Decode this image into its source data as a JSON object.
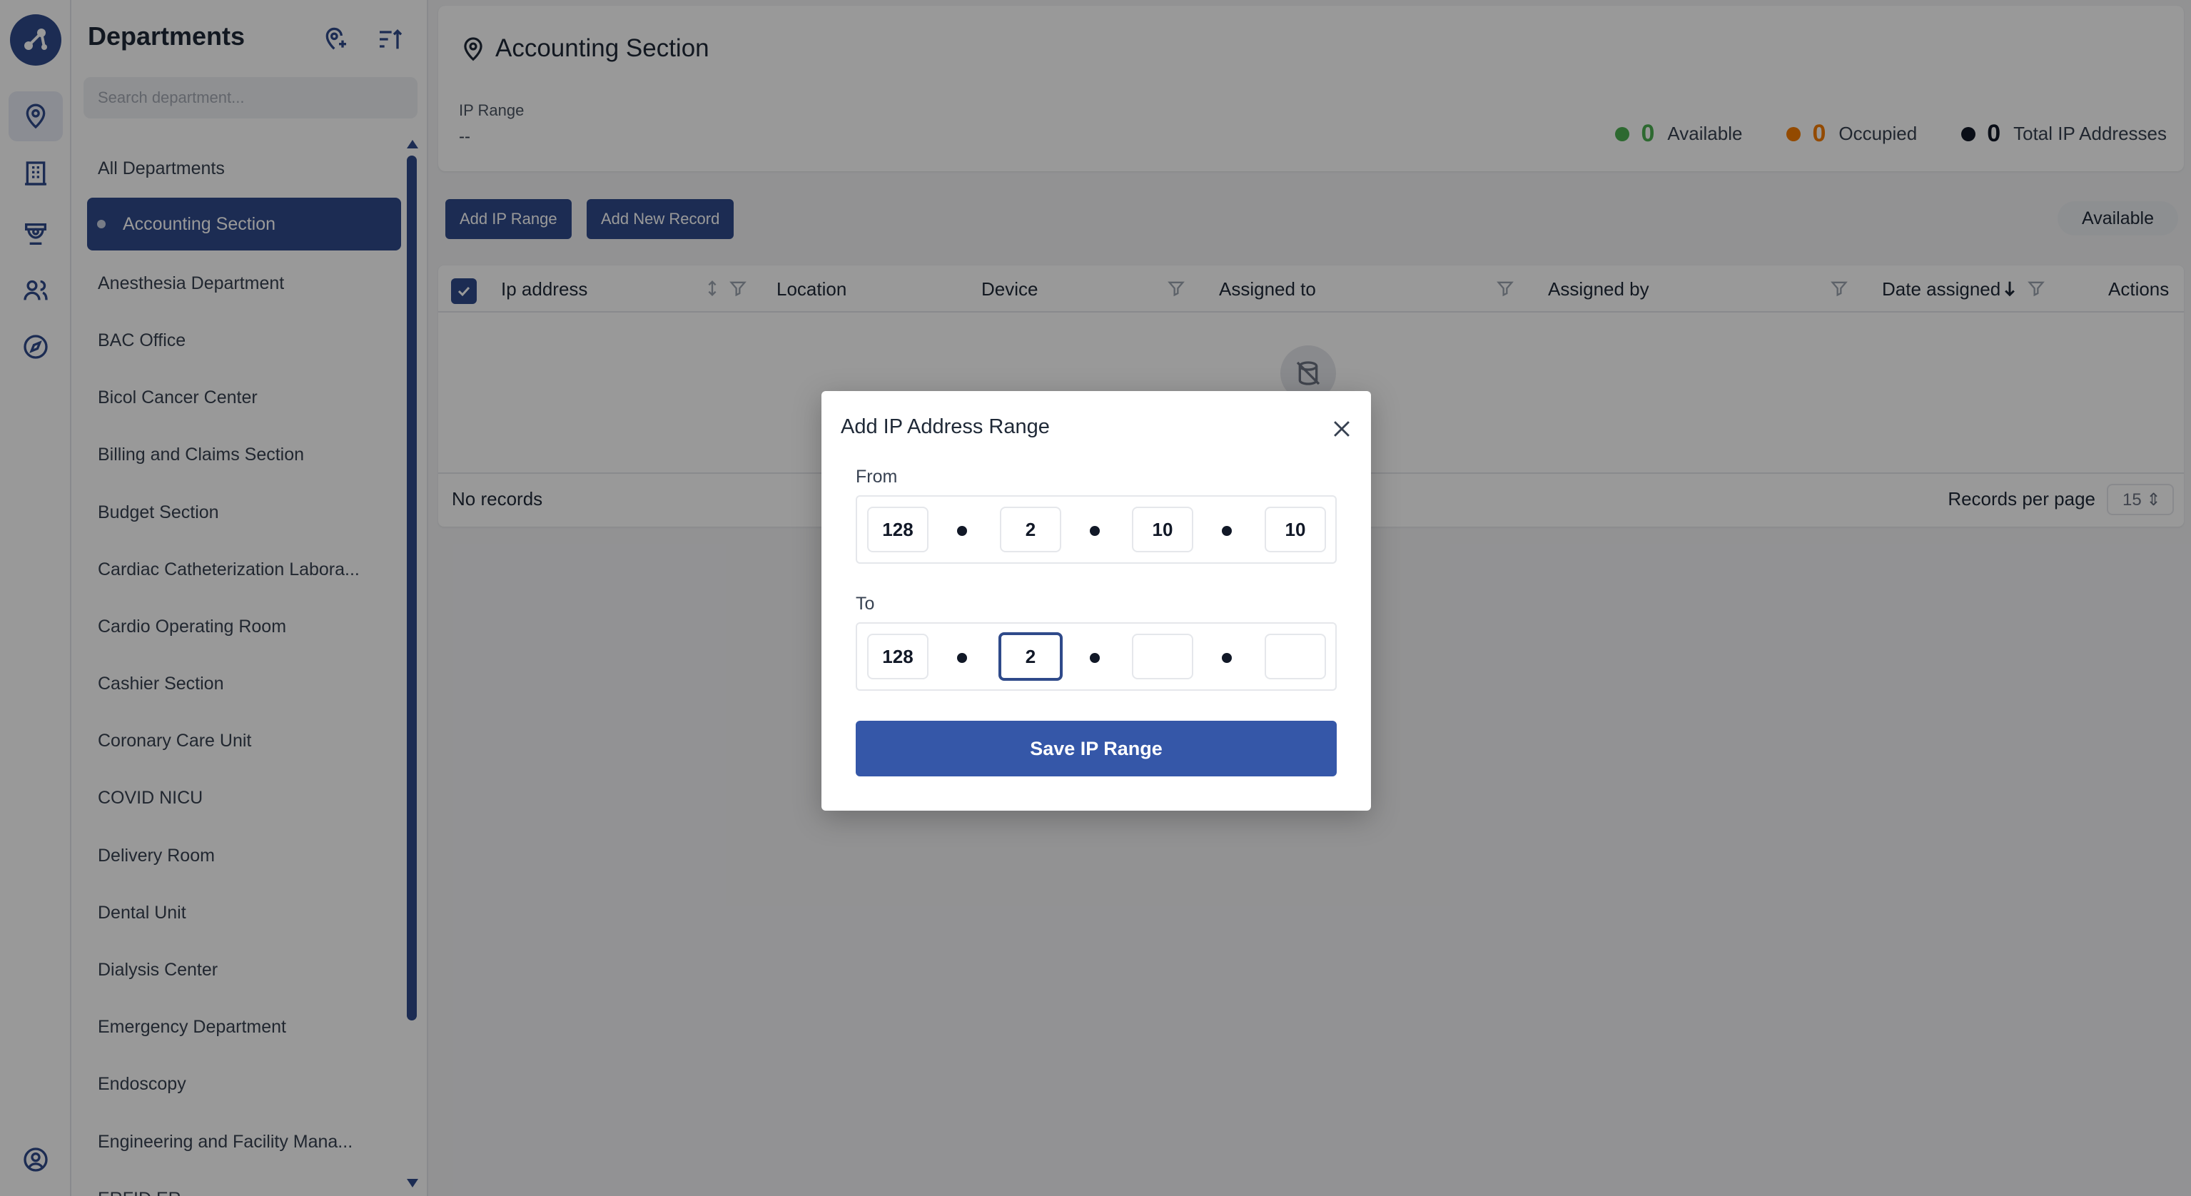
{
  "sidebar": {
    "title": "Departments",
    "search_placeholder": "Search department...",
    "items": [
      "All Departments",
      "Accounting Section",
      "Anesthesia Department",
      "BAC Office",
      "Bicol Cancer Center",
      "Billing and Claims Section",
      "Budget Section",
      "Cardiac Catheterization Labora...",
      "Cardio Operating Room",
      "Cashier Section",
      "Coronary Care Unit",
      "COVID NICU",
      "Delivery Room",
      "Dental Unit",
      "Dialysis Center",
      "Emergency Department",
      "Endoscopy",
      "Engineering and Facility Mana...",
      "ERFID ER"
    ],
    "active_index": 1
  },
  "rail": {
    "icons": [
      "logo-icon",
      "location-pin-icon",
      "building-icon",
      "cctv-icon",
      "users-icon",
      "compass-icon",
      "user-circle-icon"
    ]
  },
  "header": {
    "title": "Accounting Section",
    "ip_range_label": "IP Range",
    "ip_range_value": "--",
    "stats": {
      "available": {
        "count": "0",
        "label": "Available",
        "color": "#4caf50"
      },
      "occupied": {
        "count": "0",
        "label": "Occupied",
        "color": "#f57c00"
      },
      "total": {
        "count": "0",
        "label": "Total IP Addresses",
        "color": "#111827"
      }
    }
  },
  "toolbar": {
    "add_ip_range": "Add IP Range",
    "add_new_record": "Add New Record",
    "status_filter": "Available"
  },
  "table": {
    "columns": {
      "ip": "Ip address",
      "location": "Location",
      "device": "Device",
      "assigned_to": "Assigned to",
      "assigned_by": "Assigned by",
      "date_assigned": "Date assigned",
      "actions": "Actions"
    },
    "empty_text": "No records",
    "rows_per_page_label": "Records per page",
    "rows_per_page_value": "15 ⇕"
  },
  "modal": {
    "title": "Add IP Address Range",
    "from_label": "From",
    "to_label": "To",
    "from": [
      "128",
      "2",
      "10",
      "10"
    ],
    "to": [
      "128",
      "2",
      "",
      ""
    ],
    "save_label": "Save IP Range"
  },
  "colors": {
    "primary": "#2f4a8a",
    "save_button": "#3557a8"
  }
}
